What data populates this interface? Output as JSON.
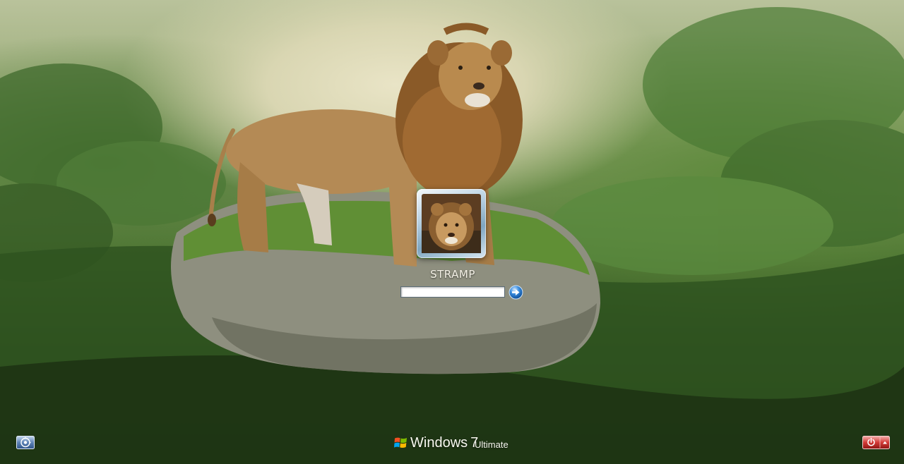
{
  "login": {
    "username": "STRAMP",
    "password_value": ""
  },
  "branding": {
    "os_name": "Windows",
    "os_version": "7",
    "os_edition": "Ultimate"
  },
  "icons": {
    "ease_of_access": "ease-of-access-icon",
    "submit": "arrow-right-icon",
    "power": "power-icon",
    "shutdown_options": "chevron-up-icon",
    "logo": "windows-logo-icon"
  },
  "colors": {
    "power_button": "#c8262c",
    "submit_button": "#2a7fd4",
    "ease_button": "#4a6fa8"
  }
}
